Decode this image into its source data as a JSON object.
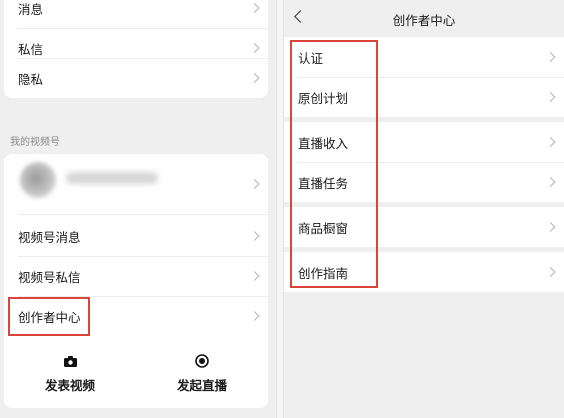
{
  "left": {
    "top_items": [
      "消息",
      "私信",
      "隐私"
    ],
    "section_label": "我的视频号",
    "channel_items": [
      "视频号消息",
      "视频号私信",
      "创作者中心"
    ],
    "actions": [
      {
        "label": "发表视频",
        "icon": "camera-icon"
      },
      {
        "label": "发起直播",
        "icon": "live-icon"
      }
    ]
  },
  "right": {
    "title": "创作者中心",
    "items": [
      "认证",
      "原创计划",
      "直播收入",
      "直播任务",
      "商品橱窗",
      "创作指南"
    ]
  },
  "colors": {
    "highlight": "#d9463c",
    "background": "#efefef",
    "card": "#ffffff"
  }
}
